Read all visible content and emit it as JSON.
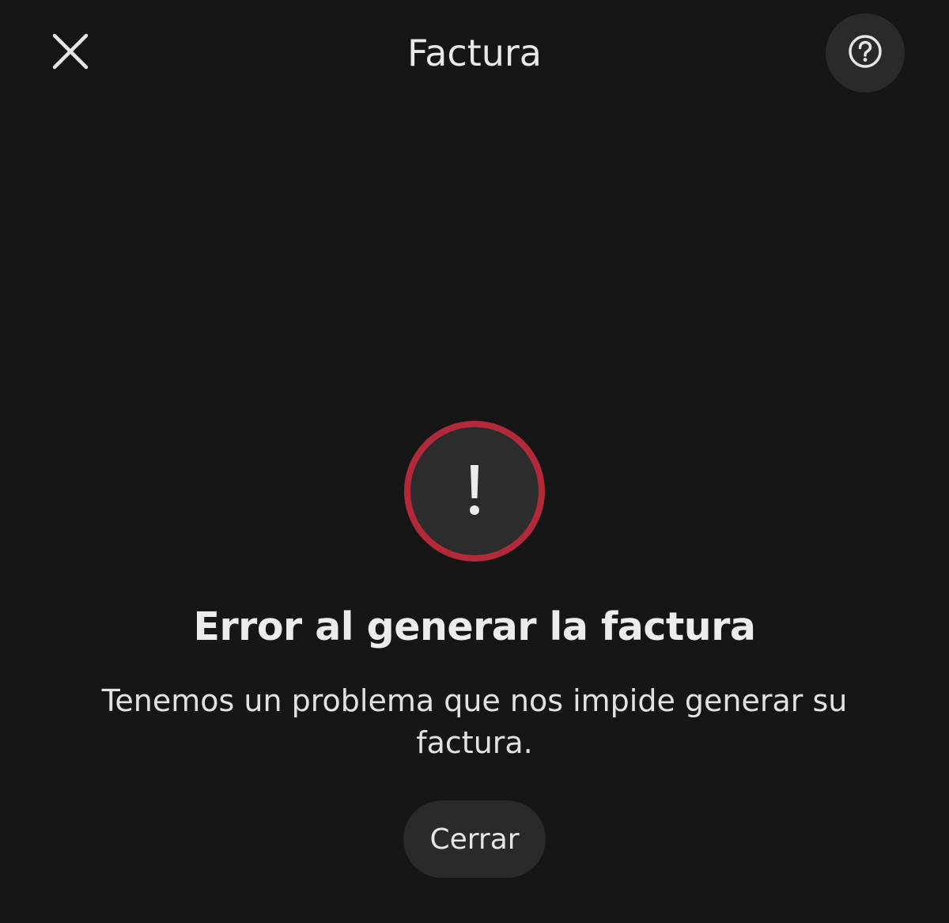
{
  "header": {
    "title": "Factura",
    "close_icon": "close-icon",
    "help_icon": "question-circle-icon"
  },
  "error": {
    "icon": "exclamation-icon",
    "icon_glyph": "!",
    "title": "Error al generar la factura",
    "message": "Tenemos un problema que nos impide generar su factura.",
    "action_label": "Cerrar"
  },
  "colors": {
    "background": "#161616",
    "accent_error": "#b22a3a",
    "surface": "#2a2a2a",
    "text": "#e8e8e8"
  }
}
